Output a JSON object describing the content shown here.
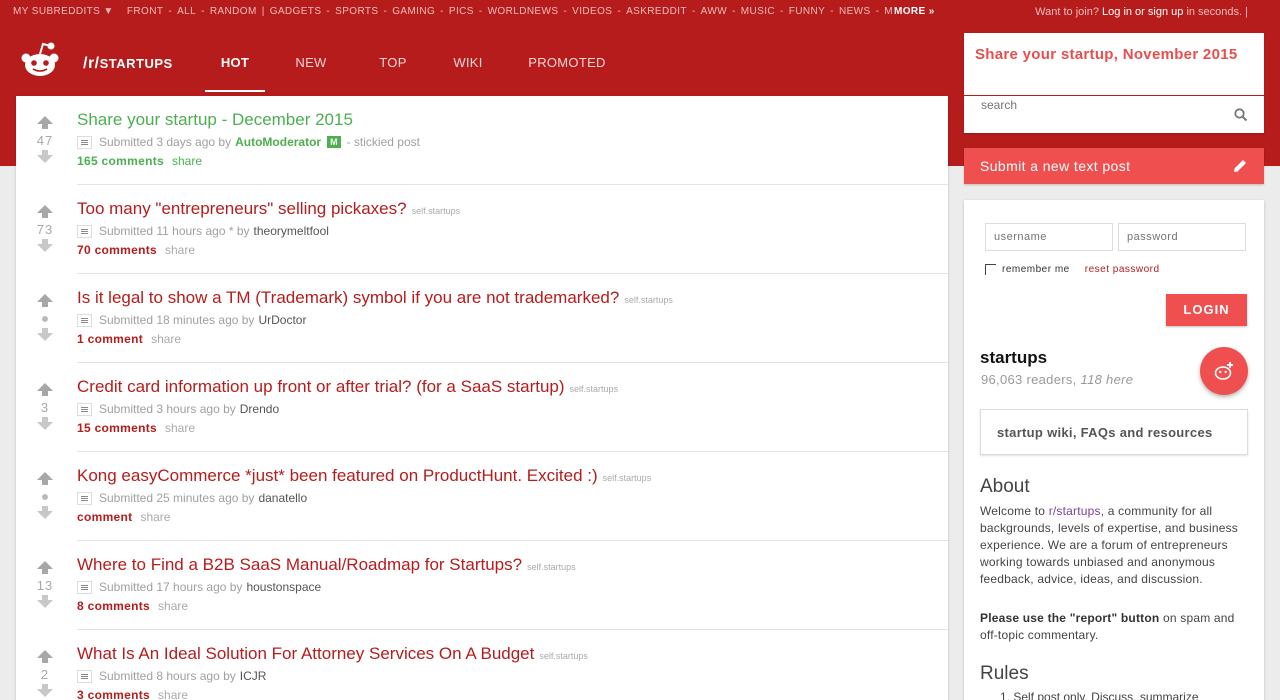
{
  "topbar": {
    "my_subreddits": "MY SUBREDDITS ▼",
    "subreddits": [
      "FRONT",
      "ALL",
      "RANDOM",
      "|",
      "GADGETS",
      "SPORTS",
      "GAMING",
      "PICS",
      "WORLDNEWS",
      "VIDEOS",
      "ASKREDDIT",
      "AWW",
      "MUSIC",
      "FUNNY",
      "NEWS",
      "MOVIES"
    ],
    "more": "MORE »",
    "join_prefix": "Want to join?",
    "join_link": "Log in or sign up",
    "join_suffix": "in seconds. |"
  },
  "header": {
    "prefix": "/r/",
    "name": "STARTUPS",
    "tabs": [
      "HOT",
      "NEW",
      "TOP",
      "WIKI",
      "PROMOTED"
    ]
  },
  "posts": [
    {
      "score": "47",
      "title": "Share your startup - December 2015",
      "domain": "",
      "submitted": "Submitted 3 days ago by",
      "author": "AutoModerator",
      "badge": "M",
      "suffix": "- stickied post",
      "comments": "165 comments",
      "share": "share"
    },
    {
      "score": "73",
      "title": "Too many \"entrepreneurs\" selling pickaxes?",
      "domain": "self.startups",
      "submitted": "Submitted 11 hours ago * by",
      "author": "theorymeltfool",
      "comments": "70 comments",
      "share": "share"
    },
    {
      "score": "•",
      "title": "Is it legal to show a TM (Trademark) symbol if you are not trademarked?",
      "domain": "self.startups",
      "submitted": "Submitted 18 minutes ago by",
      "author": "UrDoctor",
      "comments": "1 comment",
      "share": "share"
    },
    {
      "score": "3",
      "title": "Credit card information up front or after trial? (for a SaaS startup)",
      "domain": "self.startups",
      "submitted": "Submitted 3 hours ago by",
      "author": "Drendo",
      "comments": "15 comments",
      "share": "share"
    },
    {
      "score": "•",
      "title": "Kong easyCommerce *just* been featured on ProductHunt. Excited :)",
      "domain": "self.startups",
      "submitted": "Submitted 25 minutes ago by",
      "author": "danatello",
      "comments": "comment",
      "share": "share"
    },
    {
      "score": "13",
      "title": "Where to Find a B2B SaaS Manual/Roadmap for Startups?",
      "domain": "self.startups",
      "submitted": "Submitted 17 hours ago by",
      "author": "houstonspace",
      "comments": "8 comments",
      "share": "share"
    },
    {
      "score": "2",
      "title": "What Is An Ideal Solution For Attorney Services On A Budget",
      "domain": "self.startups",
      "submitted": "Submitted 8 hours ago by",
      "author": "ICJR",
      "comments": "3 comments",
      "share": "share"
    }
  ],
  "sidebar": {
    "sticky_link": "Share your startup, November 2015",
    "search_placeholder": "search",
    "submit_text": "Submit a new text post",
    "username_placeholder": "username",
    "password_placeholder": "password",
    "remember_me": "remember me",
    "reset_password": "reset password",
    "login": "LOGIN",
    "subreddit": "startups",
    "readers": "96,063 readers,",
    "here": "118 here",
    "wiki": "startup wiki, FAQs and resources",
    "about_heading": "About",
    "about_1": "Welcome to",
    "about_link": "r/startups",
    "about_2": ", a community for all backgrounds, levels of expertise, and business experience. We are a forum of entrepreneurs working towards unbiased and anonymous feedback, advice, ideas, and discussion.",
    "report_bold": "Please use the \"report\" button",
    "report_rest": "on spam and off-topic commentary.",
    "rules_heading": "Rules",
    "rule_1": "1.   Self post only. Discuss, summarize"
  },
  "colors": {
    "brand": "#b71c1c",
    "accent": "#ef4f4f",
    "stickied": "#4caf50"
  }
}
